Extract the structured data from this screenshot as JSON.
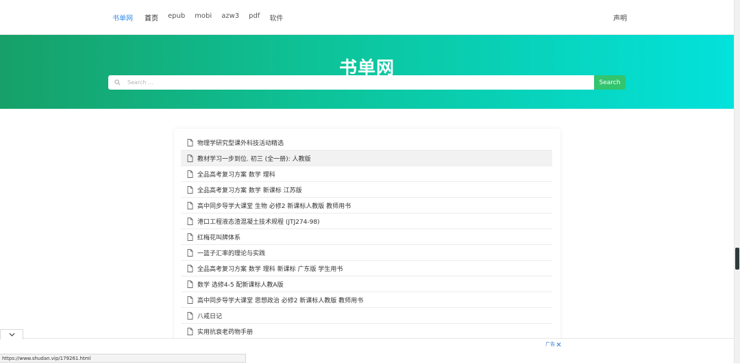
{
  "nav": {
    "brand": "书单网",
    "links": [
      "首页",
      "epub",
      "mobi",
      "azw3",
      "pdf",
      "软件"
    ],
    "right": "声明"
  },
  "hero": {
    "title": "书单网",
    "search_placeholder": "Search ...",
    "search_button": "Search"
  },
  "list": {
    "items": [
      "物理学研究型课外科技活动精选",
      "教材学习一步到位. 初三 (全一册): 人教版",
      "全品高考复习方案 数学 理科",
      "全品高考复习方案 数学 新课标 江苏版",
      "高中同步导学大课堂 生物 必修2 新课标人教版 教师用书",
      "港口工程液态渣混凝土技术规程 (JTJ274-98)",
      "红梅花叫牌体系",
      "一篮子汇率的理论与实践",
      "全品高考复习方案 数学 理科 新课标 广东版 学生用书",
      "数学 选修4-5 配新课标人教A版",
      "高中同步导学大课堂 思想政治 必修2 新课标人教版 教师用书",
      "八戒日记",
      "实用抗衰老药物手册"
    ]
  },
  "ad": {
    "label": "广告"
  },
  "status": {
    "url": "https://www.shudan.vip/179261.html"
  },
  "colors": {
    "brand": "#3a8ee6",
    "hero_start": "#17a068",
    "hero_end": "#03e2dc",
    "search_button": "#33c46e"
  }
}
